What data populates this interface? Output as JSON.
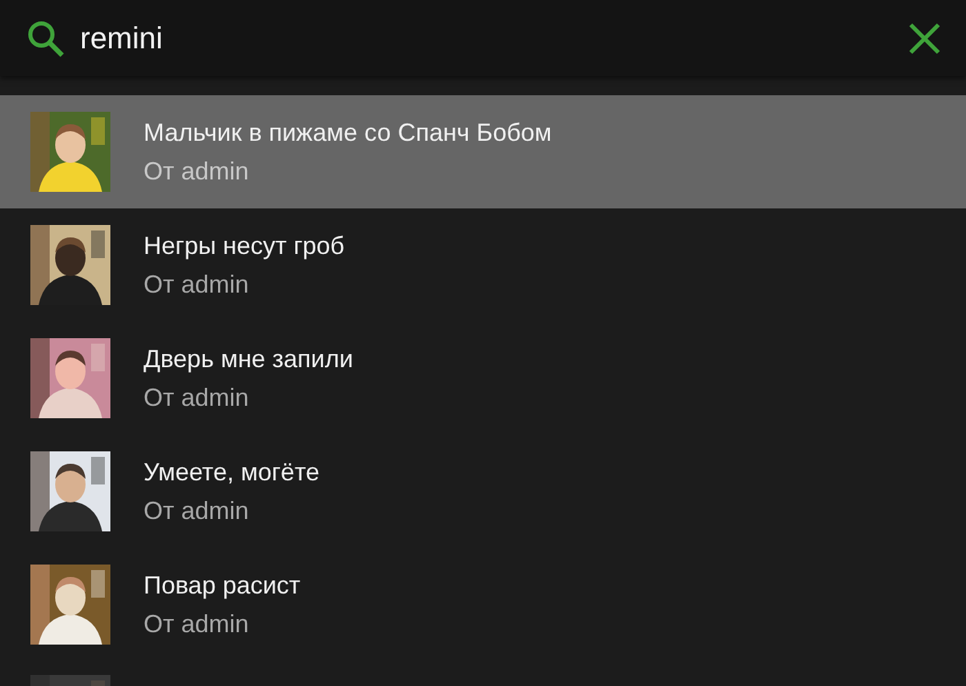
{
  "search": {
    "value": "remini"
  },
  "results": [
    {
      "title": "Мальчик в пижаме со Спанч Бобом",
      "author": "От admin",
      "selected": true
    },
    {
      "title": "Негры несут гроб",
      "author": "От admin",
      "selected": false
    },
    {
      "title": "Дверь мне запили",
      "author": "От admin",
      "selected": false
    },
    {
      "title": "Умеете, могёте",
      "author": "От admin",
      "selected": false
    },
    {
      "title": "Повар расист",
      "author": "От admin",
      "selected": false
    },
    {
      "selected": false
    }
  ]
}
